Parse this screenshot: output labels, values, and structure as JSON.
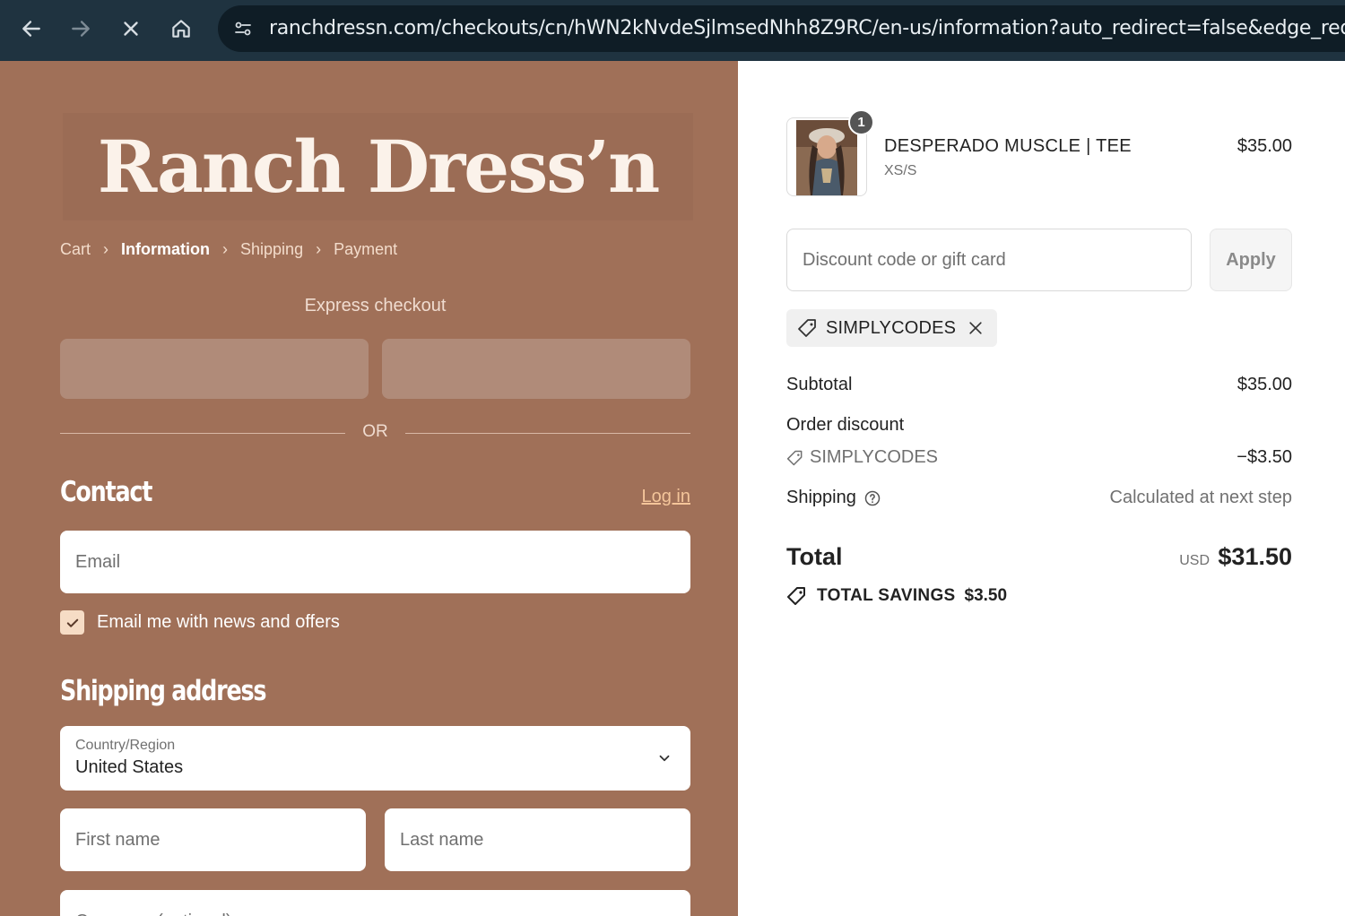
{
  "browser": {
    "url": "ranchdressn.com/checkouts/cn/hWN2kNvdeSjlmsedNhh8Z9RC/en-us/information?auto_redirect=false&edge_redirect=true&",
    "icons": [
      "arrow-left-icon",
      "arrow-right-icon",
      "close-icon",
      "home-icon",
      "site-settings-icon"
    ]
  },
  "brand": {
    "logo_text": "Ranch Dress’n"
  },
  "breadcrumb": {
    "items": [
      {
        "label": "Cart",
        "active": false
      },
      {
        "label": "Information",
        "active": true
      },
      {
        "label": "Shipping",
        "active": false
      },
      {
        "label": "Payment",
        "active": false
      }
    ],
    "separator": "›"
  },
  "express": {
    "title": "Express checkout",
    "or": "OR"
  },
  "contact": {
    "title": "Contact",
    "login_label": "Log in",
    "email_placeholder": "Email",
    "newsletter_label": "Email me with news and offers",
    "newsletter_checked": true
  },
  "shipping_address": {
    "title": "Shipping address",
    "country_label": "Country/Region",
    "country_value": "United States",
    "first_name_placeholder": "First name",
    "last_name_placeholder": "Last name",
    "company_placeholder": "Company (optional)"
  },
  "order": {
    "item": {
      "quantity": "1",
      "name": "DESPERADO MUSCLE | TEE",
      "variant": "XS/S",
      "price": "$35.00"
    },
    "discount": {
      "placeholder": "Discount code or gift card",
      "apply_label": "Apply",
      "applied_code": "SIMPLYCODES"
    },
    "summary": {
      "subtotal_label": "Subtotal",
      "subtotal_value": "$35.00",
      "order_discount_label": "Order discount",
      "discount_code": "SIMPLYCODES",
      "discount_value": "−$3.50",
      "shipping_label": "Shipping",
      "shipping_value": "Calculated at next step",
      "total_label": "Total",
      "currency": "USD",
      "total_value": "$31.50",
      "savings_label": "TOTAL SAVINGS",
      "savings_value": "$3.50"
    }
  },
  "colors": {
    "left_panel_bg": "#a07058",
    "accent_link": "#f4c59a",
    "browser_bar": "#1f3340"
  }
}
